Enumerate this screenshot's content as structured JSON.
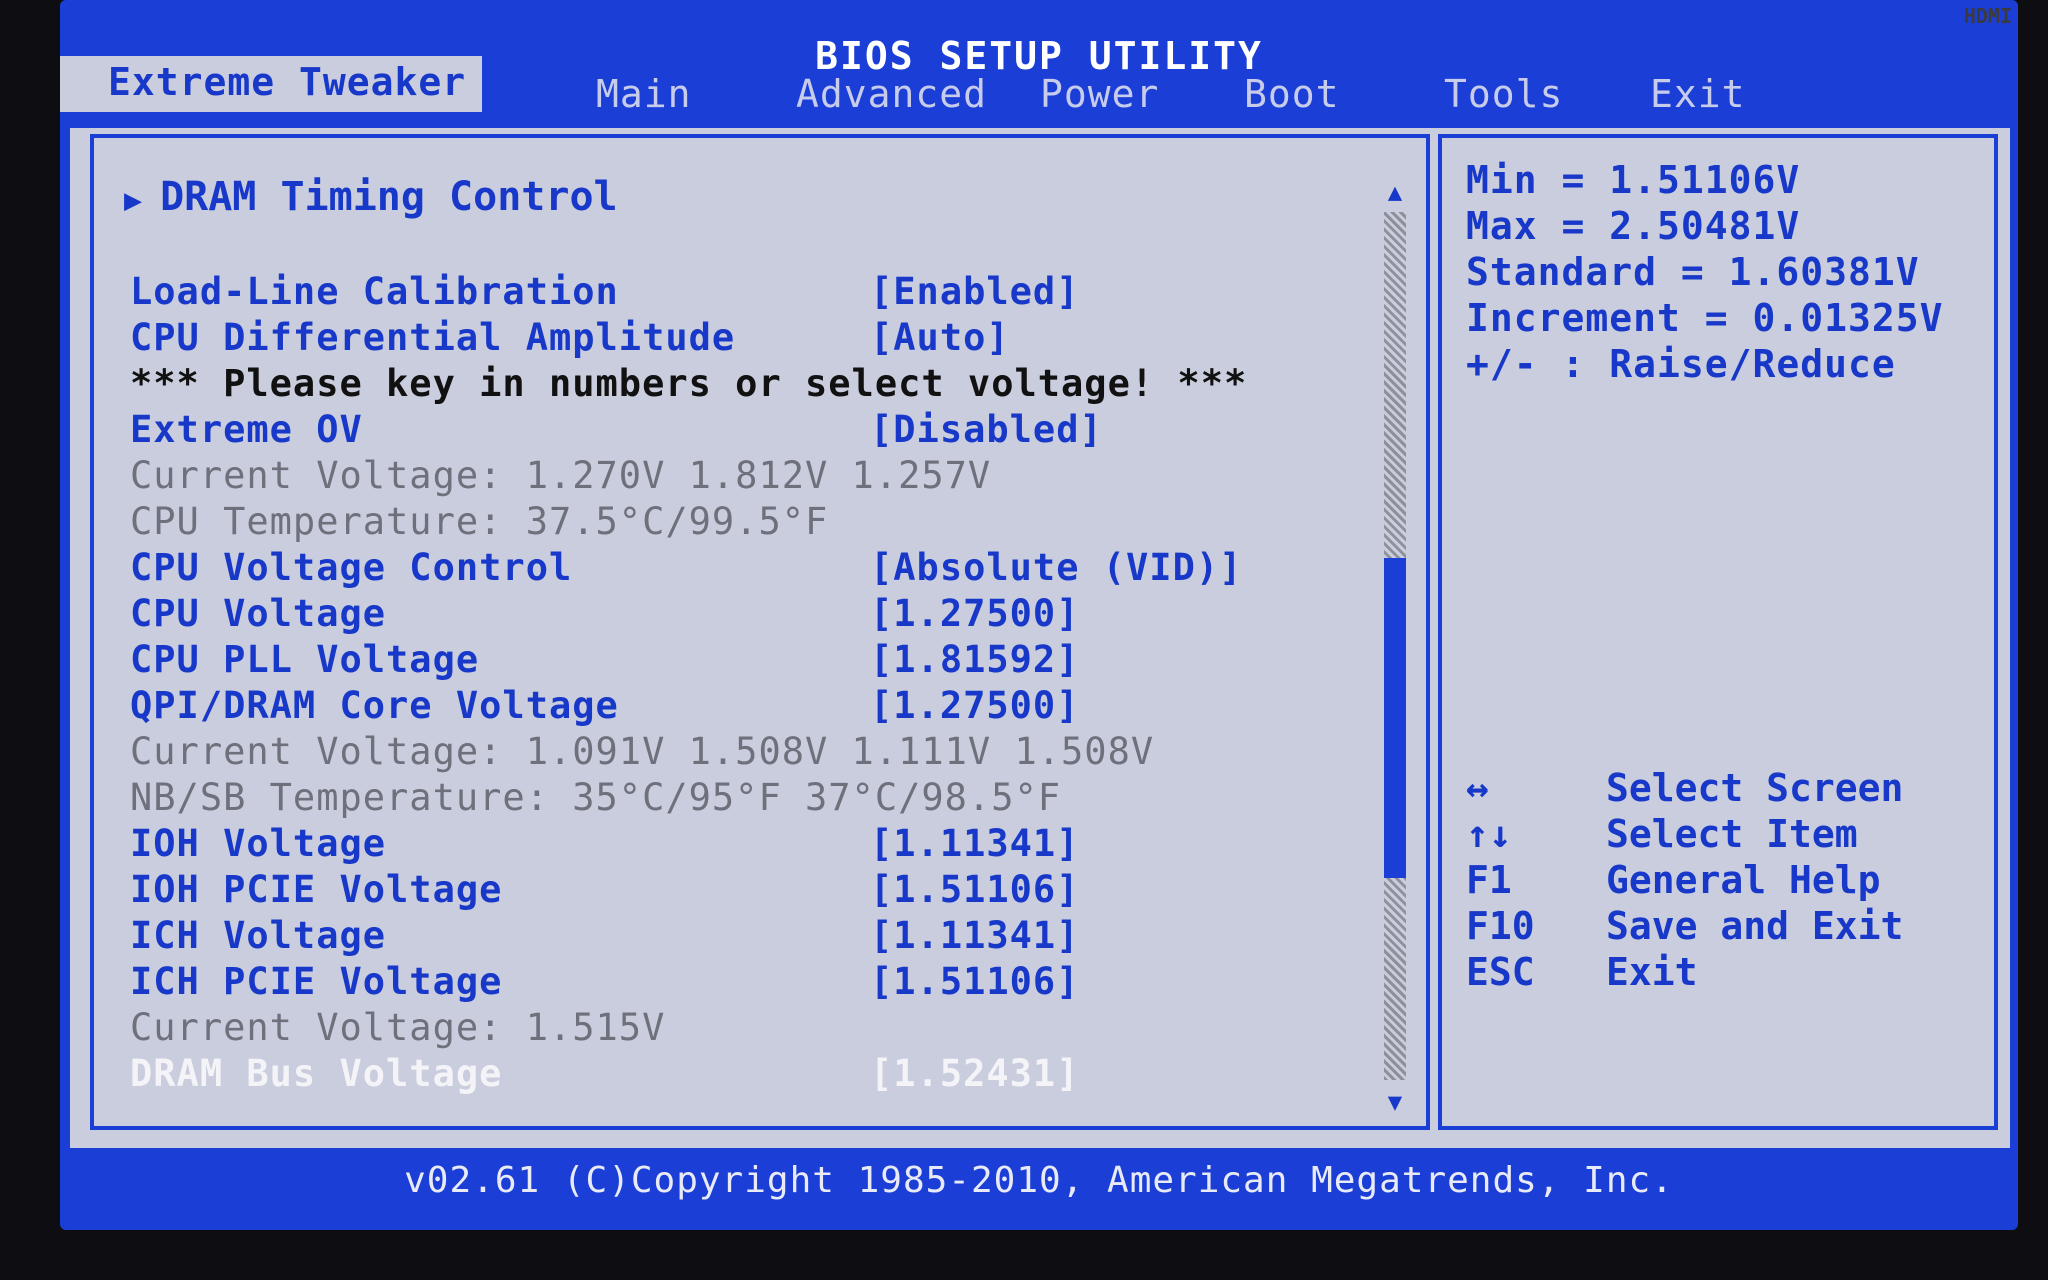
{
  "window": {
    "title": "BIOS SETUP UTILITY",
    "monitor_badge": "HDMI"
  },
  "tabs": [
    {
      "label": "Extreme Tweaker",
      "active": true
    },
    {
      "label": "Main"
    },
    {
      "label": "Advanced"
    },
    {
      "label": "Power"
    },
    {
      "label": "Boot"
    },
    {
      "label": "Tools"
    },
    {
      "label": "Exit"
    }
  ],
  "section": {
    "label": "DRAM Timing Control"
  },
  "settings": [
    {
      "label": "Load-Line Calibration",
      "value": "[Enabled]",
      "style": "blue"
    },
    {
      "label": "CPU Differential Amplitude",
      "value": "[Auto]",
      "style": "blue"
    },
    {
      "label": "*** Please key in numbers or select voltage! ***",
      "value": "",
      "style": "black"
    },
    {
      "label": "Extreme OV",
      "value": "[Disabled]",
      "style": "blue"
    },
    {
      "label": "Current Voltage: 1.270V  1.812V  1.257V",
      "value": "",
      "style": "gray"
    },
    {
      "label": "CPU Temperature: 37.5°C/99.5°F",
      "value": "",
      "style": "gray"
    },
    {
      "label": "CPU Voltage Control",
      "value": "[Absolute (VID)]",
      "style": "blue"
    },
    {
      "label": "CPU Voltage",
      "value": "[1.27500]",
      "style": "blue"
    },
    {
      "label": "CPU PLL Voltage",
      "value": "[1.81592]",
      "style": "blue"
    },
    {
      "label": "QPI/DRAM Core Voltage",
      "value": "[1.27500]",
      "style": "blue"
    },
    {
      "label": "Current Voltage: 1.091V  1.508V  1.111V  1.508V",
      "value": "",
      "style": "gray"
    },
    {
      "label": "NB/SB Temperature: 35°C/95°F  37°C/98.5°F",
      "value": "",
      "style": "gray"
    },
    {
      "label": "IOH Voltage",
      "value": "[1.11341]",
      "style": "blue"
    },
    {
      "label": "IOH PCIE Voltage",
      "value": "[1.51106]",
      "style": "blue"
    },
    {
      "label": "ICH Voltage",
      "value": "[1.11341]",
      "style": "blue"
    },
    {
      "label": "ICH PCIE Voltage",
      "value": "[1.51106]",
      "style": "blue"
    },
    {
      "label": "Current Voltage: 1.515V",
      "value": "",
      "style": "gray"
    },
    {
      "label": "DRAM Bus Voltage",
      "value": "[1.52431]",
      "style": "white"
    }
  ],
  "help": {
    "min": "Min = 1.51106V",
    "max": "Max = 2.50481V",
    "standard": "Standard  = 1.60381V",
    "increment": "Increment = 0.01325V",
    "raise_reduce": "+/- : Raise/Reduce"
  },
  "keys": [
    {
      "key": "↔",
      "action": "Select Screen"
    },
    {
      "key": "↑↓",
      "action": "Select Item"
    },
    {
      "key": "F1",
      "action": "General Help"
    },
    {
      "key": "F10",
      "action": "Save and Exit"
    },
    {
      "key": "ESC",
      "action": "Exit"
    }
  ],
  "footer": {
    "text": "v02.61 (C)Copyright 1985-2010, American Megatrends, Inc."
  },
  "colors": {
    "bios_blue": "#1b3fd6",
    "panel_gray": "#c9cddd",
    "text_blue": "#1738c8"
  }
}
